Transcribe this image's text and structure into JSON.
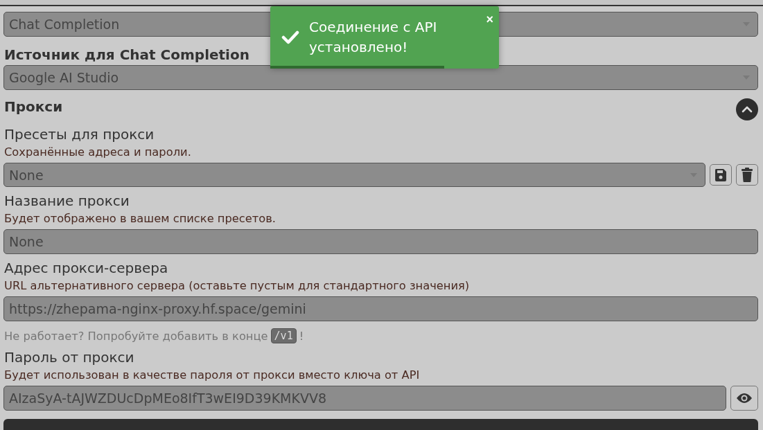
{
  "api_type_select": {
    "value": "Chat Completion"
  },
  "source": {
    "label": "Источник для Chat Completion",
    "value": "Google AI Studio"
  },
  "proxy": {
    "title": "Прокси",
    "expanded": true,
    "presets": {
      "label": "Пресеты для прокси",
      "description": "Сохранённые адреса и пароли.",
      "value": "None"
    },
    "name": {
      "label": "Название прокси",
      "description": "Будет отображено в вашем списке пресетов.",
      "value": "None"
    },
    "address": {
      "label": "Адрес прокси-сервера",
      "description": "URL альтернативного сервера (оставьте пустым для стандартного значения)",
      "value": "https://zhepama-nginx-proxy.hf.space/gemini",
      "hint": "Не работает? Попробуйте добавить в конце",
      "hint_code": "/v1",
      "hint_end": "!"
    },
    "password": {
      "label": "Пароль от прокси",
      "description": "Будет использован в качестве пароля от прокси вместо ключа от API",
      "value": "AIzaSyA-tAJWZDUcDpMEo8IfT3wEI9D39KMKVV8"
    }
  },
  "toast": {
    "message": "Соединение с API установлено!",
    "close": "×",
    "level": 0.76
  }
}
